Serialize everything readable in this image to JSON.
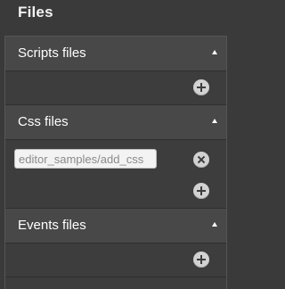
{
  "panel": {
    "title": "Files"
  },
  "sections": [
    {
      "label": "Scripts files",
      "files": []
    },
    {
      "label": "Css files",
      "files": [
        "editor_samples/add_css"
      ]
    },
    {
      "label": "Events files",
      "files": []
    }
  ],
  "icons": {
    "collapse": "triangle-up-icon",
    "add": "plus-circle-icon",
    "remove": "x-circle-icon"
  },
  "colors": {
    "background": "#3a3a3a",
    "header": "#484848",
    "button": "#d2d2d2"
  }
}
